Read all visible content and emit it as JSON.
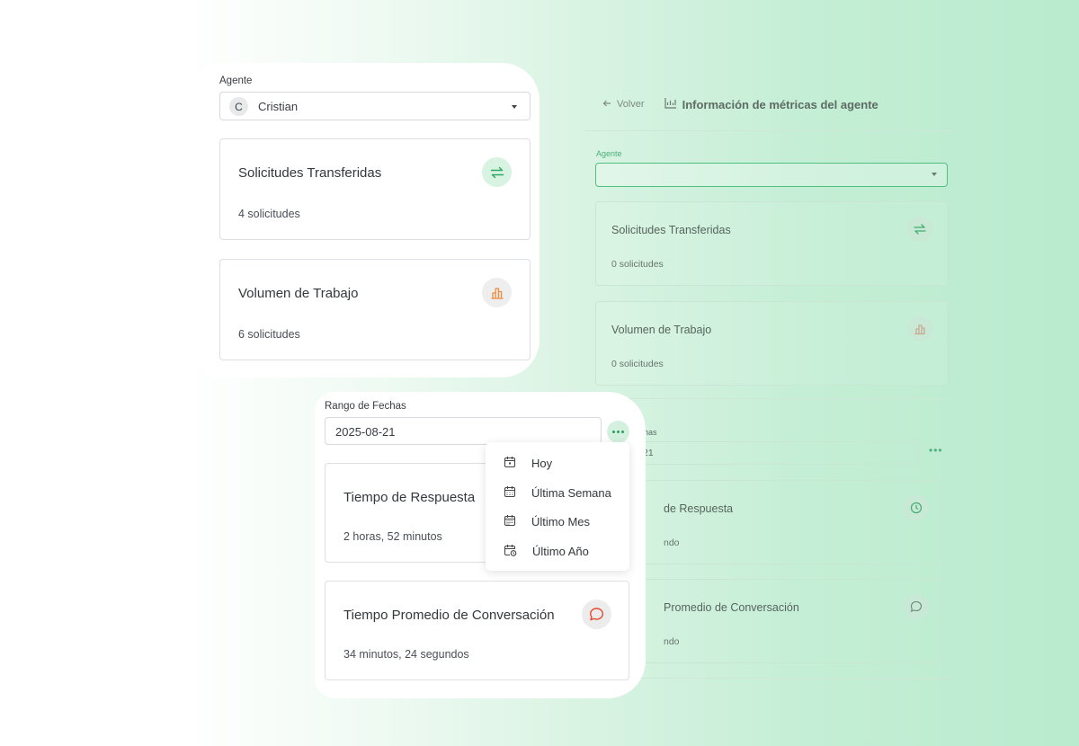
{
  "background_app": {
    "back_label": "Volver",
    "title": "Información de métricas del agente",
    "agent_label": "Agente",
    "cards": [
      {
        "title": "Solicitudes Transferidas",
        "subtitle": "0 solicitudes"
      },
      {
        "title": "Volumen de Trabajo",
        "subtitle": "0 solicitudes"
      }
    ],
    "range_label_partial": "has",
    "range_value_partial": "21",
    "time_cards": [
      {
        "title_partial": "de Respuesta",
        "subtitle_partial": "ndo"
      },
      {
        "title_partial": "Promedio de Conversación",
        "subtitle_partial": "ndo"
      }
    ]
  },
  "agent_panel": {
    "label": "Agente",
    "selected_initial": "C",
    "selected_name": "Cristian",
    "cards": [
      {
        "title": "Solicitudes Transferidas",
        "subtitle": "4 solicitudes",
        "icon": "transfer-arrows-icon",
        "color": "#2fa866",
        "bg": "#d8f3e2"
      },
      {
        "title": "Volumen de Trabajo",
        "subtitle": "6 solicitudes",
        "icon": "bar-chart-icon",
        "color": "#f08a3c",
        "bg": "#eeeeee"
      }
    ]
  },
  "range_panel": {
    "label": "Rango de Fechas",
    "date_value": "2025-08-21",
    "cards": [
      {
        "title": "Tiempo de Respuesta",
        "subtitle": "2 horas, 52 minutos"
      },
      {
        "title": "Tiempo Promedio de Conversación",
        "subtitle": "34 minutos, 24 segundos",
        "icon": "chat-bubble-icon",
        "color": "#e8462f",
        "bg": "#ececec"
      }
    ]
  },
  "date_menu": {
    "items": [
      "Hoy",
      "Última Semana",
      "Último Mes",
      "Último Año"
    ]
  }
}
